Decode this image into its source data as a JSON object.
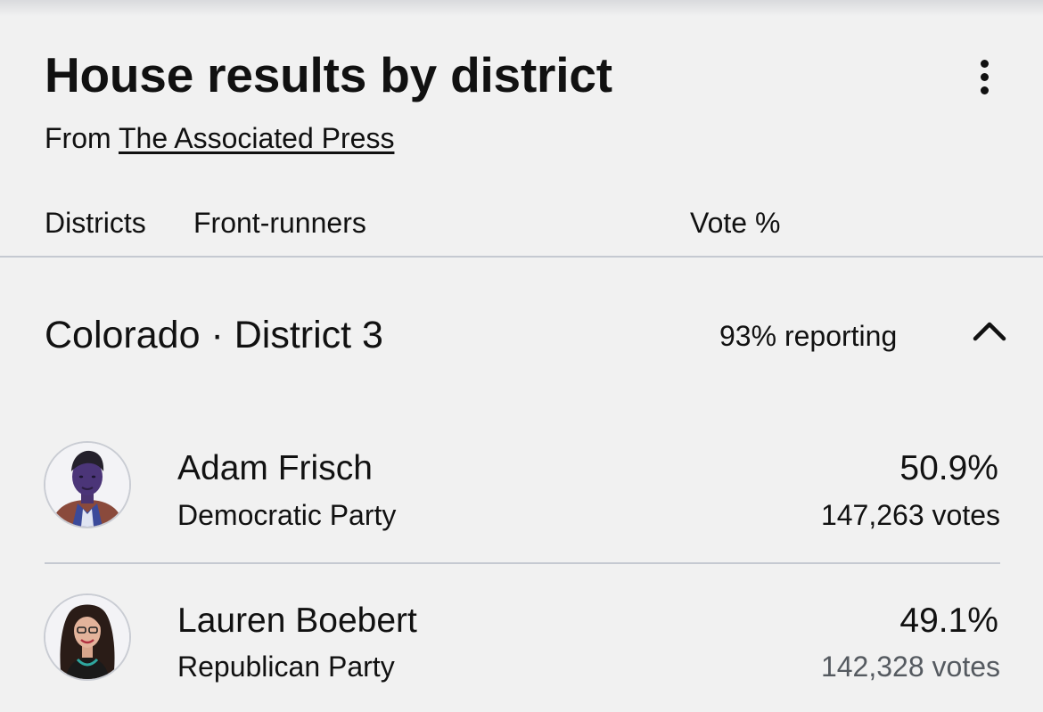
{
  "card": {
    "title": "House results by district",
    "source_prefix": "From ",
    "source_link": "The Associated Press",
    "menu_icon": "more-vert-icon"
  },
  "table_header": {
    "districts": "Districts",
    "front_runners": "Front-runners",
    "vote_pct": "Vote %"
  },
  "district": {
    "name": "Colorado · District 3",
    "reporting": "93% reporting",
    "toggle_icon": "chevron-up-icon",
    "candidates": [
      {
        "name": "Adam Frisch",
        "party": "Democratic Party",
        "vote_pct": "50.9%",
        "votes": "147,263 votes",
        "avatar_icon": "candidate-photo-icon"
      },
      {
        "name": "Lauren Boebert",
        "party": "Republican Party",
        "vote_pct": "49.1%",
        "votes": "142,328 votes",
        "avatar_icon": "candidate-photo-icon"
      }
    ]
  },
  "colors": {
    "background": "#f1f1f1",
    "divider": "#c5c9d1",
    "text": "#111111",
    "muted_text": "#555a60"
  }
}
